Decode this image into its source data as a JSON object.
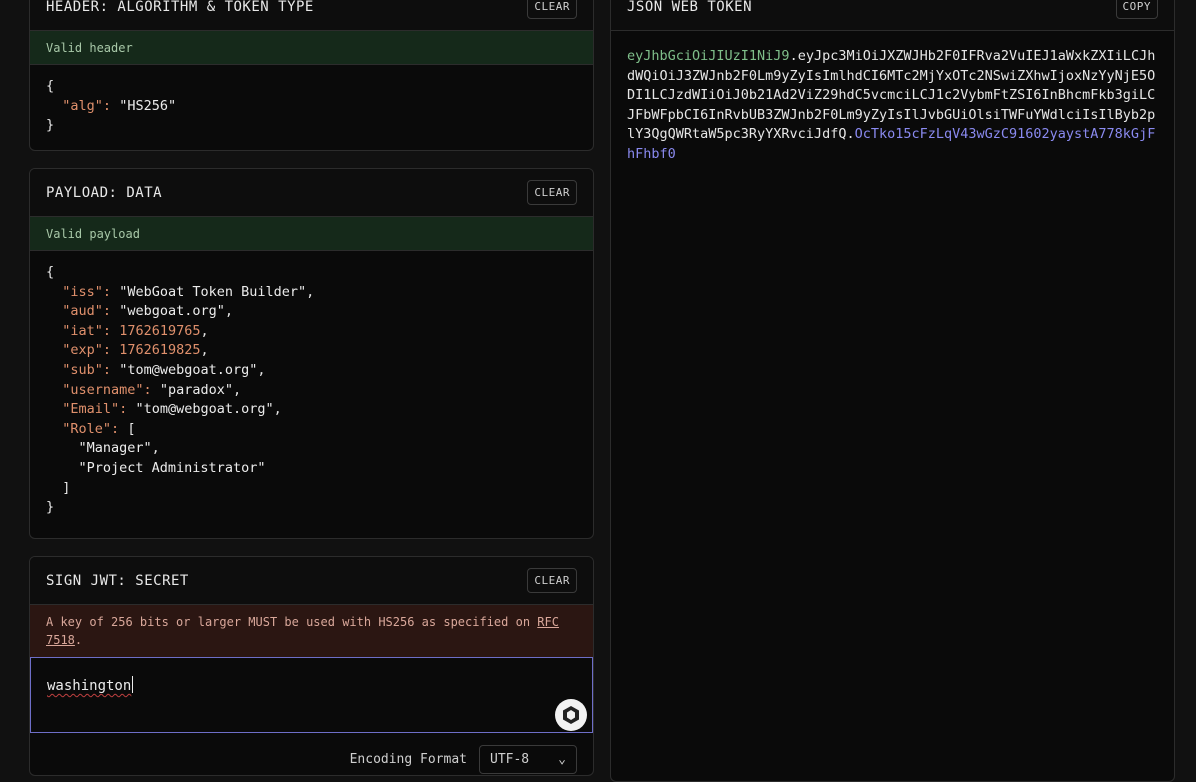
{
  "header": {
    "title": "HEADER: ALGORITHM & TOKEN TYPE",
    "clear_label": "CLEAR",
    "status": "Valid header",
    "alg_key": "\"alg\"",
    "alg_value": "\"HS256\""
  },
  "payload": {
    "title": "PAYLOAD: DATA",
    "clear_label": "CLEAR",
    "status": "Valid payload",
    "fields": {
      "iss_key": "\"iss\"",
      "iss": "\"WebGoat Token Builder\"",
      "aud_key": "\"aud\"",
      "aud": "\"webgoat.org\"",
      "iat_key": "\"iat\"",
      "iat": "1762619765",
      "exp_key": "\"exp\"",
      "exp": "1762619825",
      "sub_key": "\"sub\"",
      "sub": "\"tom@webgoat.org\"",
      "username_key": "\"username\"",
      "username": "\"paradox\"",
      "email_key": "\"Email\"",
      "email": "\"tom@webgoat.org\"",
      "role_key": "\"Role\"",
      "role_0": "\"Manager\"",
      "role_1": "\"Project Administrator\""
    }
  },
  "sign": {
    "title": "SIGN JWT: SECRET",
    "clear_label": "CLEAR",
    "warning_prefix": "A key of 256 bits or larger MUST be used with HS256 as specified on ",
    "warning_link": "RFC 7518",
    "warning_suffix": ".",
    "secret_value": "washington",
    "encoding_label": "Encoding Format",
    "encoding_value": "UTF-8"
  },
  "jwt": {
    "title": "JSON WEB TOKEN",
    "copy_label": "COPY",
    "header_part": "eyJhbGciOiJIUzI1NiJ9",
    "payload_part": "eyJpc3MiOiJXZWJHb2F0IFRva2VuIEJ1aWxkZXIiLCJhdWQiOiJ3ZWJnb2F0Lm9yZyIsImlhdCI6MTc2MjYxOTc2NSwiZXhwIjoxNzYyNjE5ODI1LCJzdWIiOiJ0b21Ad2ViZ29hdC5vcmciLCJ1c2VybmFtZSI6InBhcmFkb3giLCJFbWFpbCI6InRvbUB3ZWJnb2F0Lm9yZyIsIlJvbGUiOlsiTWFuYWdlciIsIlByb2plY3QgQWRtaW5pc3RyYXRvciJdfQ",
    "signature_part": "OcTko15cFzLqV43wGzC91602yaystA778kGjFhFhbf0",
    "dot": "."
  },
  "icons": {
    "extension": "extension-badge-icon",
    "dropdown": "chevron-down-icon"
  }
}
